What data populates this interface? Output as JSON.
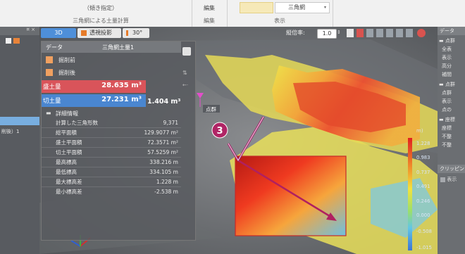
{
  "ribbon": {
    "hint_top": "（傾き指定）",
    "group1_label": "三角網による土量計算",
    "edit_button": "編集",
    "edit_group": "編集",
    "display_select": "三角網",
    "display_group": "表示"
  },
  "view_toolbar": {
    "mode_3d": "3D",
    "projection": "透視投影",
    "angle": "30°",
    "vertical_scale_label": "縦倍率:",
    "vertical_scale_value": "1.0"
  },
  "data_panel": {
    "header_label": "データ",
    "title": "三角網土量1",
    "before_label": "掘削前",
    "after_label": "掘削後",
    "cut_label": "盛土量",
    "cut_value": "28.635 m³",
    "fill_label": "切土量",
    "fill_value": "27.231 m³",
    "balance_value": "1.404 m³",
    "details_header": "詳細情報",
    "details": [
      {
        "label": "計算した三角形数",
        "value": "9,371"
      },
      {
        "label": "総平面積",
        "value": "129.9077 m²"
      },
      {
        "label": "盛土平面積",
        "value": "72.3571 m²"
      },
      {
        "label": "切土平面積",
        "value": "57.5259 m²"
      },
      {
        "label": "最高標高",
        "value": "338.216 m"
      },
      {
        "label": "最低標高",
        "value": "334.105 m"
      },
      {
        "label": "最大標高差",
        "value": "1.228 m"
      },
      {
        "label": "最小標高差",
        "value": "-2.538 m"
      }
    ]
  },
  "left_strip": {
    "close_marks": "¤ ×",
    "selected_item": "削後）1"
  },
  "viewport": {
    "marker_label": "点群",
    "step_number": "3"
  },
  "color_scale": {
    "unit": "m)",
    "values": [
      "1.228",
      "0.983",
      "0.737",
      "0.491",
      "0.246",
      "0.000",
      "-0.508",
      "-1.015"
    ]
  },
  "right_panel": {
    "header": "データ",
    "items": [
      "点群",
      "全表",
      "表示",
      "高分",
      "補間",
      "点群",
      "点群",
      "表示",
      "点の",
      "座標",
      "座標",
      "不整",
      "不整"
    ],
    "bottom_label": "クリッピン",
    "bottom_check": "表示"
  }
}
